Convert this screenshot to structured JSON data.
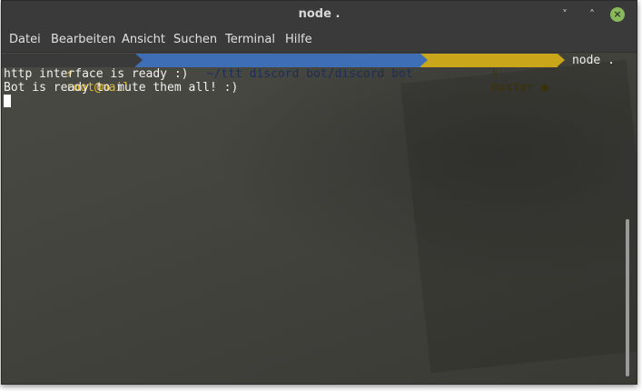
{
  "window": {
    "title": "node .",
    "buttons": {
      "minimize": "˅",
      "maximize": "˄",
      "close": "×"
    }
  },
  "menu": {
    "items": [
      "Datei",
      "Bearbeiten",
      "Ansicht",
      "Suchen",
      "Terminal",
      "Hilfe"
    ]
  },
  "prompt": {
    "user_icon": "⚡",
    "user": "root@mail",
    "path": "~/ttt discord bot/discord bot",
    "branch_icon": "ᛋ",
    "branch": "master ●",
    "command": "node ."
  },
  "output": {
    "lines": [
      "http interface is ready :)",
      "Bot is ready to mute them all! :)"
    ]
  },
  "colors": {
    "user_fg": "#e0b830",
    "path_bg": "#3e6fb6",
    "git_bg": "#c9a61a",
    "close_button": "#8ab85c"
  }
}
